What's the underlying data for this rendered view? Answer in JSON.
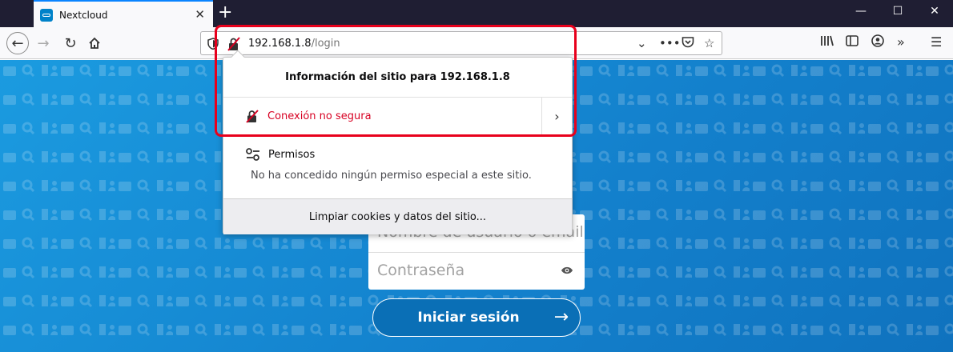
{
  "tab": {
    "title": "Nextcloud"
  },
  "urlbar": {
    "host": "192.168.1.8",
    "path": "/login"
  },
  "popup": {
    "header": "Información del sitio para 192.168.1.8",
    "connection": "Conexión no segura",
    "permissions_title": "Permisos",
    "permissions_desc": "No ha concedido ningún permiso especial a este sitio.",
    "clear_button": "Limpiar cookies y datos del sitio..."
  },
  "login": {
    "username_placeholder": "Nombre de usuario o email",
    "password_placeholder": "Contraseña",
    "submit_label": "Iniciar sesión"
  },
  "colors": {
    "brand": "#0082c9",
    "insecure": "#d70022",
    "highlight": "#e8001c"
  }
}
